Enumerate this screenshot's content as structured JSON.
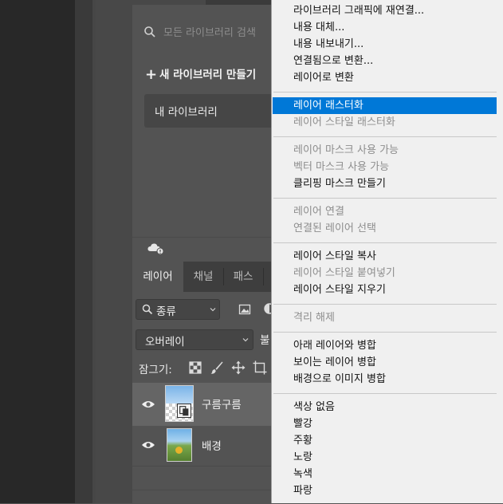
{
  "libraries": {
    "search_placeholder": "모든 라이브러리 검색",
    "new_library": "새 라이브러리 만들기",
    "my_library": "내 라이브러리",
    "more_indicator": "⋮"
  },
  "layers_panel": {
    "tabs": [
      "레이어",
      "채널",
      "패스"
    ],
    "kind_filter": "종류",
    "blend_mode": "오버레이",
    "opacity_label_partial": "불",
    "lock_label": "잠그기:",
    "layers": [
      {
        "name": "구름구름",
        "selected": true,
        "visible": true
      },
      {
        "name": "배경",
        "selected": false,
        "visible": true
      }
    ]
  },
  "context_menu": {
    "items": [
      {
        "label": "라이브러리 그래픽에 재연결...",
        "state": "enabled"
      },
      {
        "label": "내용 대체...",
        "state": "enabled"
      },
      {
        "label": "내용 내보내기...",
        "state": "enabled"
      },
      {
        "label": "연결됨으로 변환...",
        "state": "enabled"
      },
      {
        "label": "레이어로 변환",
        "state": "enabled"
      },
      {
        "separator": true
      },
      {
        "label": "레이어 래스터화",
        "state": "highlighted"
      },
      {
        "label": "레이어 스타일 래스터화",
        "state": "disabled"
      },
      {
        "separator": true
      },
      {
        "label": "레이어 마스크 사용 가능",
        "state": "disabled"
      },
      {
        "label": "벡터 마스크 사용 가능",
        "state": "disabled"
      },
      {
        "label": "클리핑 마스크 만들기",
        "state": "enabled"
      },
      {
        "separator": true
      },
      {
        "label": "레이어 연결",
        "state": "disabled"
      },
      {
        "label": "연결된 레이어 선택",
        "state": "disabled"
      },
      {
        "separator": true
      },
      {
        "label": "레이어 스타일 복사",
        "state": "enabled"
      },
      {
        "label": "레이어 스타일 붙여넣기",
        "state": "disabled"
      },
      {
        "label": "레이어 스타일 지우기",
        "state": "enabled"
      },
      {
        "separator": true
      },
      {
        "label": "격리 해제",
        "state": "disabled"
      },
      {
        "separator": true
      },
      {
        "label": "아래 레이어와 병합",
        "state": "enabled"
      },
      {
        "label": "보이는 레이어 병합",
        "state": "enabled"
      },
      {
        "label": "배경으로 이미지 병합",
        "state": "enabled"
      },
      {
        "separator": true
      },
      {
        "label": "색상 없음",
        "state": "enabled"
      },
      {
        "label": "빨강",
        "state": "enabled"
      },
      {
        "label": "주황",
        "state": "enabled"
      },
      {
        "label": "노랑",
        "state": "enabled"
      },
      {
        "label": "녹색",
        "state": "enabled"
      },
      {
        "label": "파랑",
        "state": "enabled"
      }
    ]
  },
  "colors": {
    "menu_highlight": "#0078d7",
    "menu_background": "#f0f0f0",
    "panel_background": "#535353"
  }
}
